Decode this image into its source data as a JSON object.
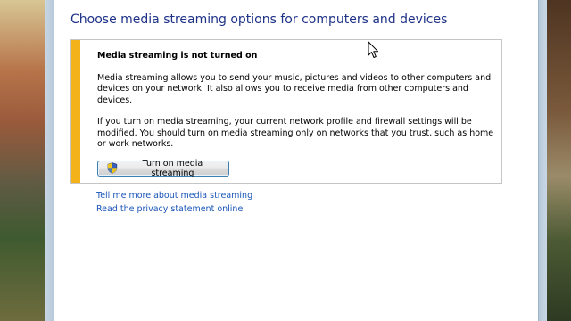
{
  "page": {
    "title": "Choose media streaming options for computers and devices"
  },
  "panel": {
    "heading": "Media streaming is not turned on",
    "paragraph1": "Media streaming allows you to send your music, pictures and videos to other computers and devices on your network.  It also allows you to receive media from other computers and devices.",
    "paragraph2": "If you turn on media streaming, your current network profile and firewall settings will be modified. You should turn on media streaming only on networks that you trust, such as home or work networks.",
    "button_label": "Turn on media streaming",
    "button_icon": "uac-shield-icon",
    "accent_color": "#f3b21a"
  },
  "links": {
    "learn_more": "Tell me more about media streaming",
    "privacy": "Read the privacy statement online"
  },
  "colors": {
    "title": "#1e3287",
    "link": "#1a55b8"
  }
}
